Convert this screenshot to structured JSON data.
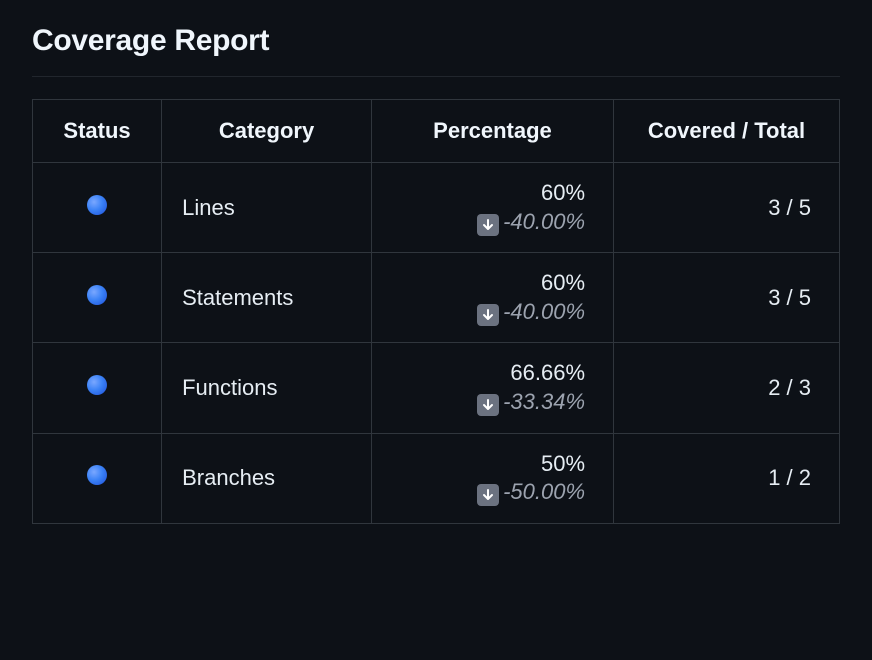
{
  "title": "Coverage Report",
  "columns": {
    "status": "Status",
    "category": "Category",
    "percentage": "Percentage",
    "covered": "Covered / Total"
  },
  "rows": [
    {
      "category": "Lines",
      "percentage": "60%",
      "delta": "-40.00%",
      "covered": "3 / 5",
      "status_color": "#3b82f6"
    },
    {
      "category": "Statements",
      "percentage": "60%",
      "delta": "-40.00%",
      "covered": "3 / 5",
      "status_color": "#3b82f6"
    },
    {
      "category": "Functions",
      "percentage": "66.66%",
      "delta": "-33.34%",
      "covered": "2 / 3",
      "status_color": "#3b82f6"
    },
    {
      "category": "Branches",
      "percentage": "50%",
      "delta": "-50.00%",
      "covered": "1 / 2",
      "status_color": "#3b82f6"
    }
  ]
}
